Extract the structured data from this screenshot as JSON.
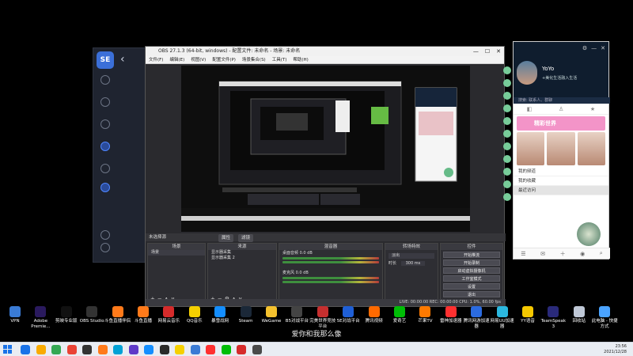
{
  "obs": {
    "title": "OBS 27.1.3 (64-bit, windows) - 配置文件: 未命名 - 场景: 未命名",
    "menu": [
      "文件(F)",
      "编辑(E)",
      "视图(V)",
      "配置文件(P)",
      "场景集合(S)",
      "工具(T)",
      "帮助(H)"
    ],
    "no_source": "未选择源",
    "tabs": [
      "属性",
      "滤镜"
    ],
    "scenes_header": "场景",
    "scenes": [
      "场景"
    ],
    "sources_header": "来源",
    "sources": [
      "显示器采集",
      "显示器采集 2"
    ],
    "mixer_header": "混音器",
    "mixer_tracks": [
      {
        "label": "桌面音频",
        "value": "0.0 dB"
      },
      {
        "label": "麦克风",
        "value": "0.0 dB"
      }
    ],
    "transition_header": "转场特效",
    "transition_type": "淡出",
    "duration_label": "时长",
    "duration_value": "300 ms",
    "controls_header": "控件",
    "controls": [
      "开始推流",
      "开始录制",
      "启动虚拟摄像机",
      "工作室模式",
      "设置",
      "退出"
    ],
    "status": "LIVE: 00:00:00   REC: 00:00:00   CPU: 1.0%, 60.00 fps"
  },
  "qq": {
    "name": "YoYo",
    "signature": "+美化生活融入生活",
    "search_placeholder": "搜索: 联系人、群聊",
    "banner": "精彩世界",
    "list": [
      "我的频道",
      "我的收藏",
      "最近访问"
    ]
  },
  "desktop_icons": [
    {
      "label": "VPN",
      "color": "#3a7bd5"
    },
    {
      "label": "Adobe Premie...",
      "color": "#2a1a5e"
    },
    {
      "label": "剪映专业版",
      "color": "#111111"
    },
    {
      "label": "OBS Studio",
      "color": "#333333"
    },
    {
      "label": "斗鱼直播伴侣",
      "color": "#ff7a1a"
    },
    {
      "label": "斗鱼直播",
      "color": "#ff7a1a"
    },
    {
      "label": "网易云音乐",
      "color": "#d62b2b"
    },
    {
      "label": "QQ音乐",
      "color": "#f5d000"
    },
    {
      "label": "暴雪战网",
      "color": "#148eff"
    },
    {
      "label": "Steam",
      "color": "#1b2838"
    },
    {
      "label": "WeGame",
      "color": "#f4c12e"
    },
    {
      "label": "B5对战平台",
      "color": "#444444"
    },
    {
      "label": "完美世界竞技平台",
      "color": "#c62f2f"
    },
    {
      "label": "5E对战平台",
      "color": "#1f5fd6"
    },
    {
      "label": "腾讯视频",
      "color": "#ff6a00"
    },
    {
      "label": "爱奇艺",
      "color": "#00be06"
    },
    {
      "label": "芒果TV",
      "color": "#ff7a00"
    },
    {
      "label": "雷神加速器",
      "color": "#ff3030"
    },
    {
      "label": "腾讯网游加速器",
      "color": "#2b6be0"
    },
    {
      "label": "网易UU加速器",
      "color": "#2bb8e0"
    },
    {
      "label": "YY语音",
      "color": "#f5c800"
    },
    {
      "label": "TeamSpeak 3",
      "color": "#2a2a7a"
    },
    {
      "label": "回收站",
      "color": "#bfc8d6"
    },
    {
      "label": "此电脑 - 快捷方式",
      "color": "#4aa3ff"
    }
  ],
  "caption": "爱你和我那么像",
  "clock": {
    "time": "23:56",
    "date": "2021/12/28"
  },
  "taskbar_apps": [
    "#1a73e8",
    "#f9ab00",
    "#34a853",
    "#ea4335",
    "#333333",
    "#ff7a1a",
    "#00a1d6",
    "#5e3ac8",
    "#148eff",
    "#2a2a2a",
    "#f5d000",
    "#3a7bd5",
    "#ff3030",
    "#00be06",
    "#d62b2b",
    "#4a4a4a"
  ]
}
